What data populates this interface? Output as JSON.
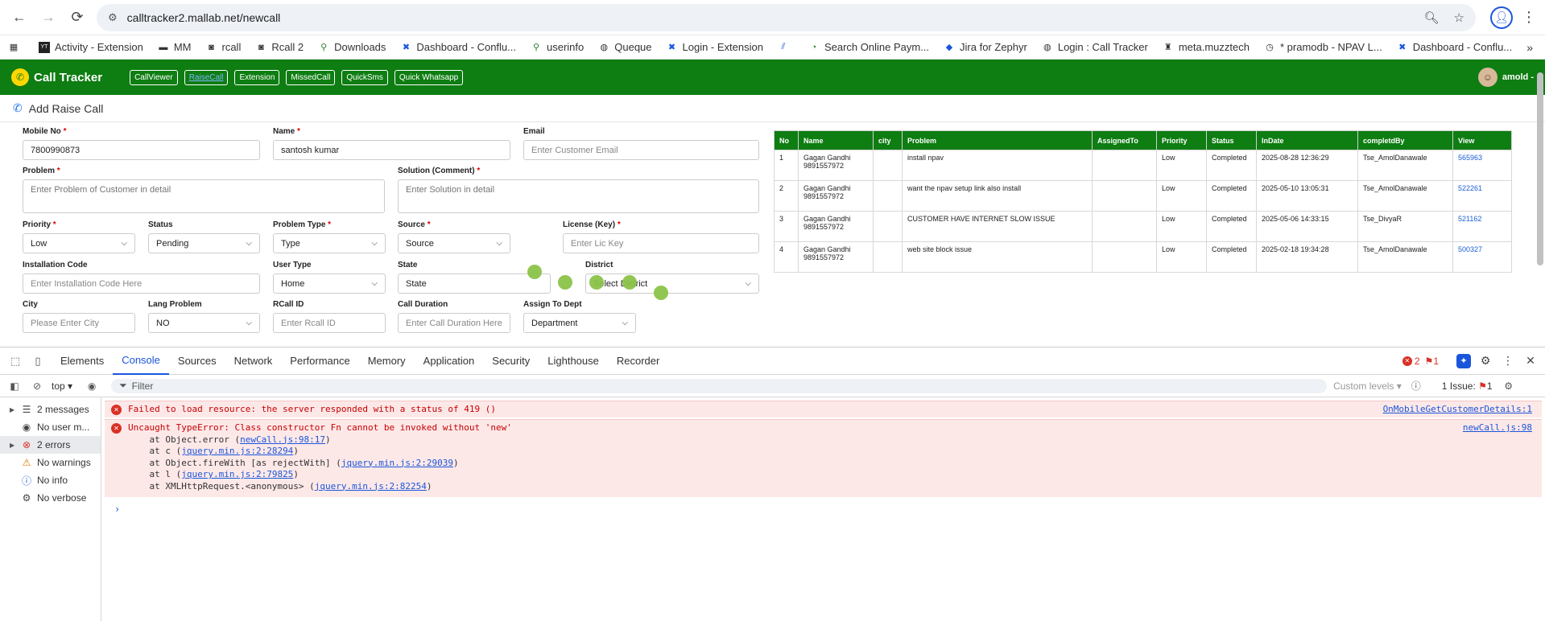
{
  "browser": {
    "url": "calltracker2.mallab.net/newcall",
    "bookmarks": [
      "Activity - Extension",
      "MM",
      "rcall",
      "Rcall 2",
      "Downloads",
      "Dashboard - Conflu...",
      "userinfo",
      "Queque",
      "Login - Extension",
      "Search Online Paym...",
      "Jira for Zephyr",
      "Login : Call Tracker",
      "meta.muzztech",
      "* pramodb - NPAV L...",
      "Dashboard - Conflu..."
    ]
  },
  "app": {
    "brand": "Call Tracker",
    "nav": [
      "CallViewer",
      "RaiseCall",
      "Extension",
      "MissedCall",
      "QuickSms",
      "Quick Whatsapp"
    ],
    "user": "amold -",
    "page_title": "Add Raise Call"
  },
  "form": {
    "mobile": {
      "label": "Mobile No",
      "value": "7800990873"
    },
    "name": {
      "label": "Name",
      "value": "santosh kumar"
    },
    "email": {
      "label": "Email",
      "placeholder": "Enter Customer Email"
    },
    "problem": {
      "label": "Problem",
      "placeholder": "Enter Problem of Customer in detail"
    },
    "solution": {
      "label": "Solution (Comment)",
      "placeholder": "Enter Solution in detail"
    },
    "priority": {
      "label": "Priority",
      "value": "Low"
    },
    "status": {
      "label": "Status",
      "value": "Pending"
    },
    "problem_type": {
      "label": "Problem Type",
      "value": "Type"
    },
    "source": {
      "label": "Source",
      "value": "Source"
    },
    "license": {
      "label": "License (Key)",
      "placeholder": "Enter Lic Key"
    },
    "installation": {
      "label": "Installation Code",
      "placeholder": "Enter Installation Code Here"
    },
    "user_type": {
      "label": "User Type",
      "value": "Home"
    },
    "state": {
      "label": "State",
      "value": "State"
    },
    "district": {
      "label": "District",
      "value": "Select District"
    },
    "city": {
      "label": "City",
      "placeholder": "Please Enter City"
    },
    "lang_problem": {
      "label": "Lang Problem",
      "value": "NO"
    },
    "rcall_id": {
      "label": "RCall ID",
      "placeholder": "Enter Rcall ID"
    },
    "call_duration": {
      "label": "Call Duration",
      "placeholder": "Enter Call Duration Here"
    },
    "assign_dept": {
      "label": "Assign To Dept",
      "value": "Department"
    },
    "req": "*"
  },
  "table": {
    "headers": [
      "No",
      "Name",
      "city",
      "Problem",
      "AssignedTo",
      "Priority",
      "Status",
      "InDate",
      "completdBy",
      "View"
    ],
    "rows": [
      {
        "no": "1",
        "name": "Gagan Gandhi",
        "phone": "9891557972",
        "city": "",
        "problem": "install npav",
        "assigned": "",
        "priority": "Low",
        "status": "Completed",
        "indate": "2025-08-28 12:36:29",
        "by": "Tse_AmolDanawale",
        "view": "565963"
      },
      {
        "no": "2",
        "name": "Gagan Gandhi",
        "phone": "9891557972",
        "city": "",
        "problem": "want the npav setup link also install",
        "assigned": "",
        "priority": "Low",
        "status": "Completed",
        "indate": "2025-05-10 13:05:31",
        "by": "Tse_AmolDanawale",
        "view": "522261"
      },
      {
        "no": "3",
        "name": "Gagan Gandhi",
        "phone": "9891557972",
        "city": "",
        "problem": "CUSTOMER HAVE INTERNET SLOW ISSUE",
        "assigned": "",
        "priority": "Low",
        "status": "Completed",
        "indate": "2025-05-06 14:33:15",
        "by": "Tse_DivyaR",
        "view": "521162"
      },
      {
        "no": "4",
        "name": "Gagan Gandhi",
        "phone": "9891557972",
        "city": "",
        "problem": "web site block issue",
        "assigned": "",
        "priority": "Low",
        "status": "Completed",
        "indate": "2025-02-18 19:34:28",
        "by": "Tse_AmolDanawale",
        "view": "500327"
      }
    ]
  },
  "devtools": {
    "tabs": [
      "Elements",
      "Console",
      "Sources",
      "Network",
      "Performance",
      "Memory",
      "Application",
      "Security",
      "Lighthouse",
      "Recorder"
    ],
    "error_count": "2",
    "issue_count": "1",
    "context": "top",
    "filter_placeholder": "Filter",
    "levels": "Custom levels",
    "issues_label": "1 Issue:",
    "issues_num": "1",
    "sidebar": [
      {
        "label": "2 messages",
        "icon": "list-icon",
        "expandable": true
      },
      {
        "label": "No user m...",
        "icon": "user-icon",
        "expandable": false
      },
      {
        "label": "2 errors",
        "icon": "error-icon",
        "expandable": true
      },
      {
        "label": "No warnings",
        "icon": "warning-icon",
        "expandable": false
      },
      {
        "label": "No info",
        "icon": "info-icon",
        "expandable": false
      },
      {
        "label": "No verbose",
        "icon": "bug-icon",
        "expandable": false
      }
    ],
    "messages": {
      "m1_text": "Failed to load resource: the server responded with a status of 419 ()",
      "m1_src": "OnMobileGetCustomerDetails:1",
      "m2_text": "Uncaught TypeError: Class constructor Fn cannot be invoked without 'new'",
      "m2_src": "newCall.js:98",
      "stack": [
        {
          "pre": "    at Object.error (",
          "link": "newCall.js:98:17",
          "post": ")"
        },
        {
          "pre": "    at c (",
          "link": "jquery.min.js:2:28294",
          "post": ")"
        },
        {
          "pre": "    at Object.fireWith [as rejectWith] (",
          "link": "jquery.min.js:2:29039",
          "post": ")"
        },
        {
          "pre": "    at l (",
          "link": "jquery.min.js:2:79825",
          "post": ")"
        },
        {
          "pre": "    at XMLHttpRequest.<anonymous> (",
          "link": "jquery.min.js:2:82254",
          "post": ")"
        }
      ]
    }
  },
  "colors": {
    "brand_green": "#0e7d12",
    "accent_blue": "#1a56db",
    "error_red": "#d93025"
  }
}
